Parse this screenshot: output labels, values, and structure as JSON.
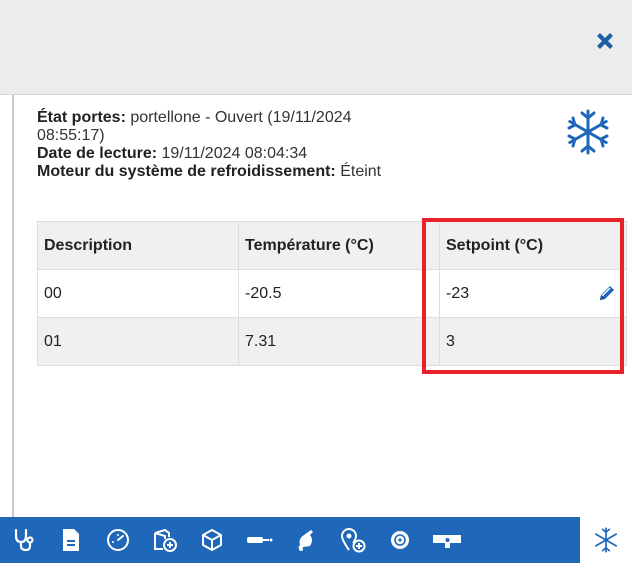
{
  "colors": {
    "accent": "#1f67b8",
    "highlight": "#e8222a",
    "header_bg": "#ececec",
    "alt_row": "#f0f0f0"
  },
  "header": {
    "close_icon": "close-icon"
  },
  "info": {
    "door_label": "État portes:",
    "door_value": " portellone - Ouvert (19/11/2024",
    "door_value_cont": "08:55:17)",
    "read_label": "Date de lecture:",
    "read_value": " 19/11/2024 08:04:34",
    "motor_label": "Moteur du système de refroidissement:",
    "motor_value": " Éteint",
    "status_icon": "snowflake-icon"
  },
  "table": {
    "headers": [
      "Description",
      "Température (°C)",
      "Setpoint (°C)"
    ],
    "rows": [
      {
        "description": "00",
        "temperature": "-20.5",
        "setpoint": "-23"
      },
      {
        "description": "01",
        "temperature": "7.31",
        "setpoint": "3"
      }
    ]
  },
  "toolbar": {
    "icons": [
      "stethoscope-icon",
      "document-icon",
      "gauge-icon",
      "add-device-icon",
      "cube-icon",
      "sensor-icon",
      "bell-icon",
      "add-location-icon",
      "wheel-icon",
      "truck-icon",
      "snowflake-icon"
    ]
  }
}
